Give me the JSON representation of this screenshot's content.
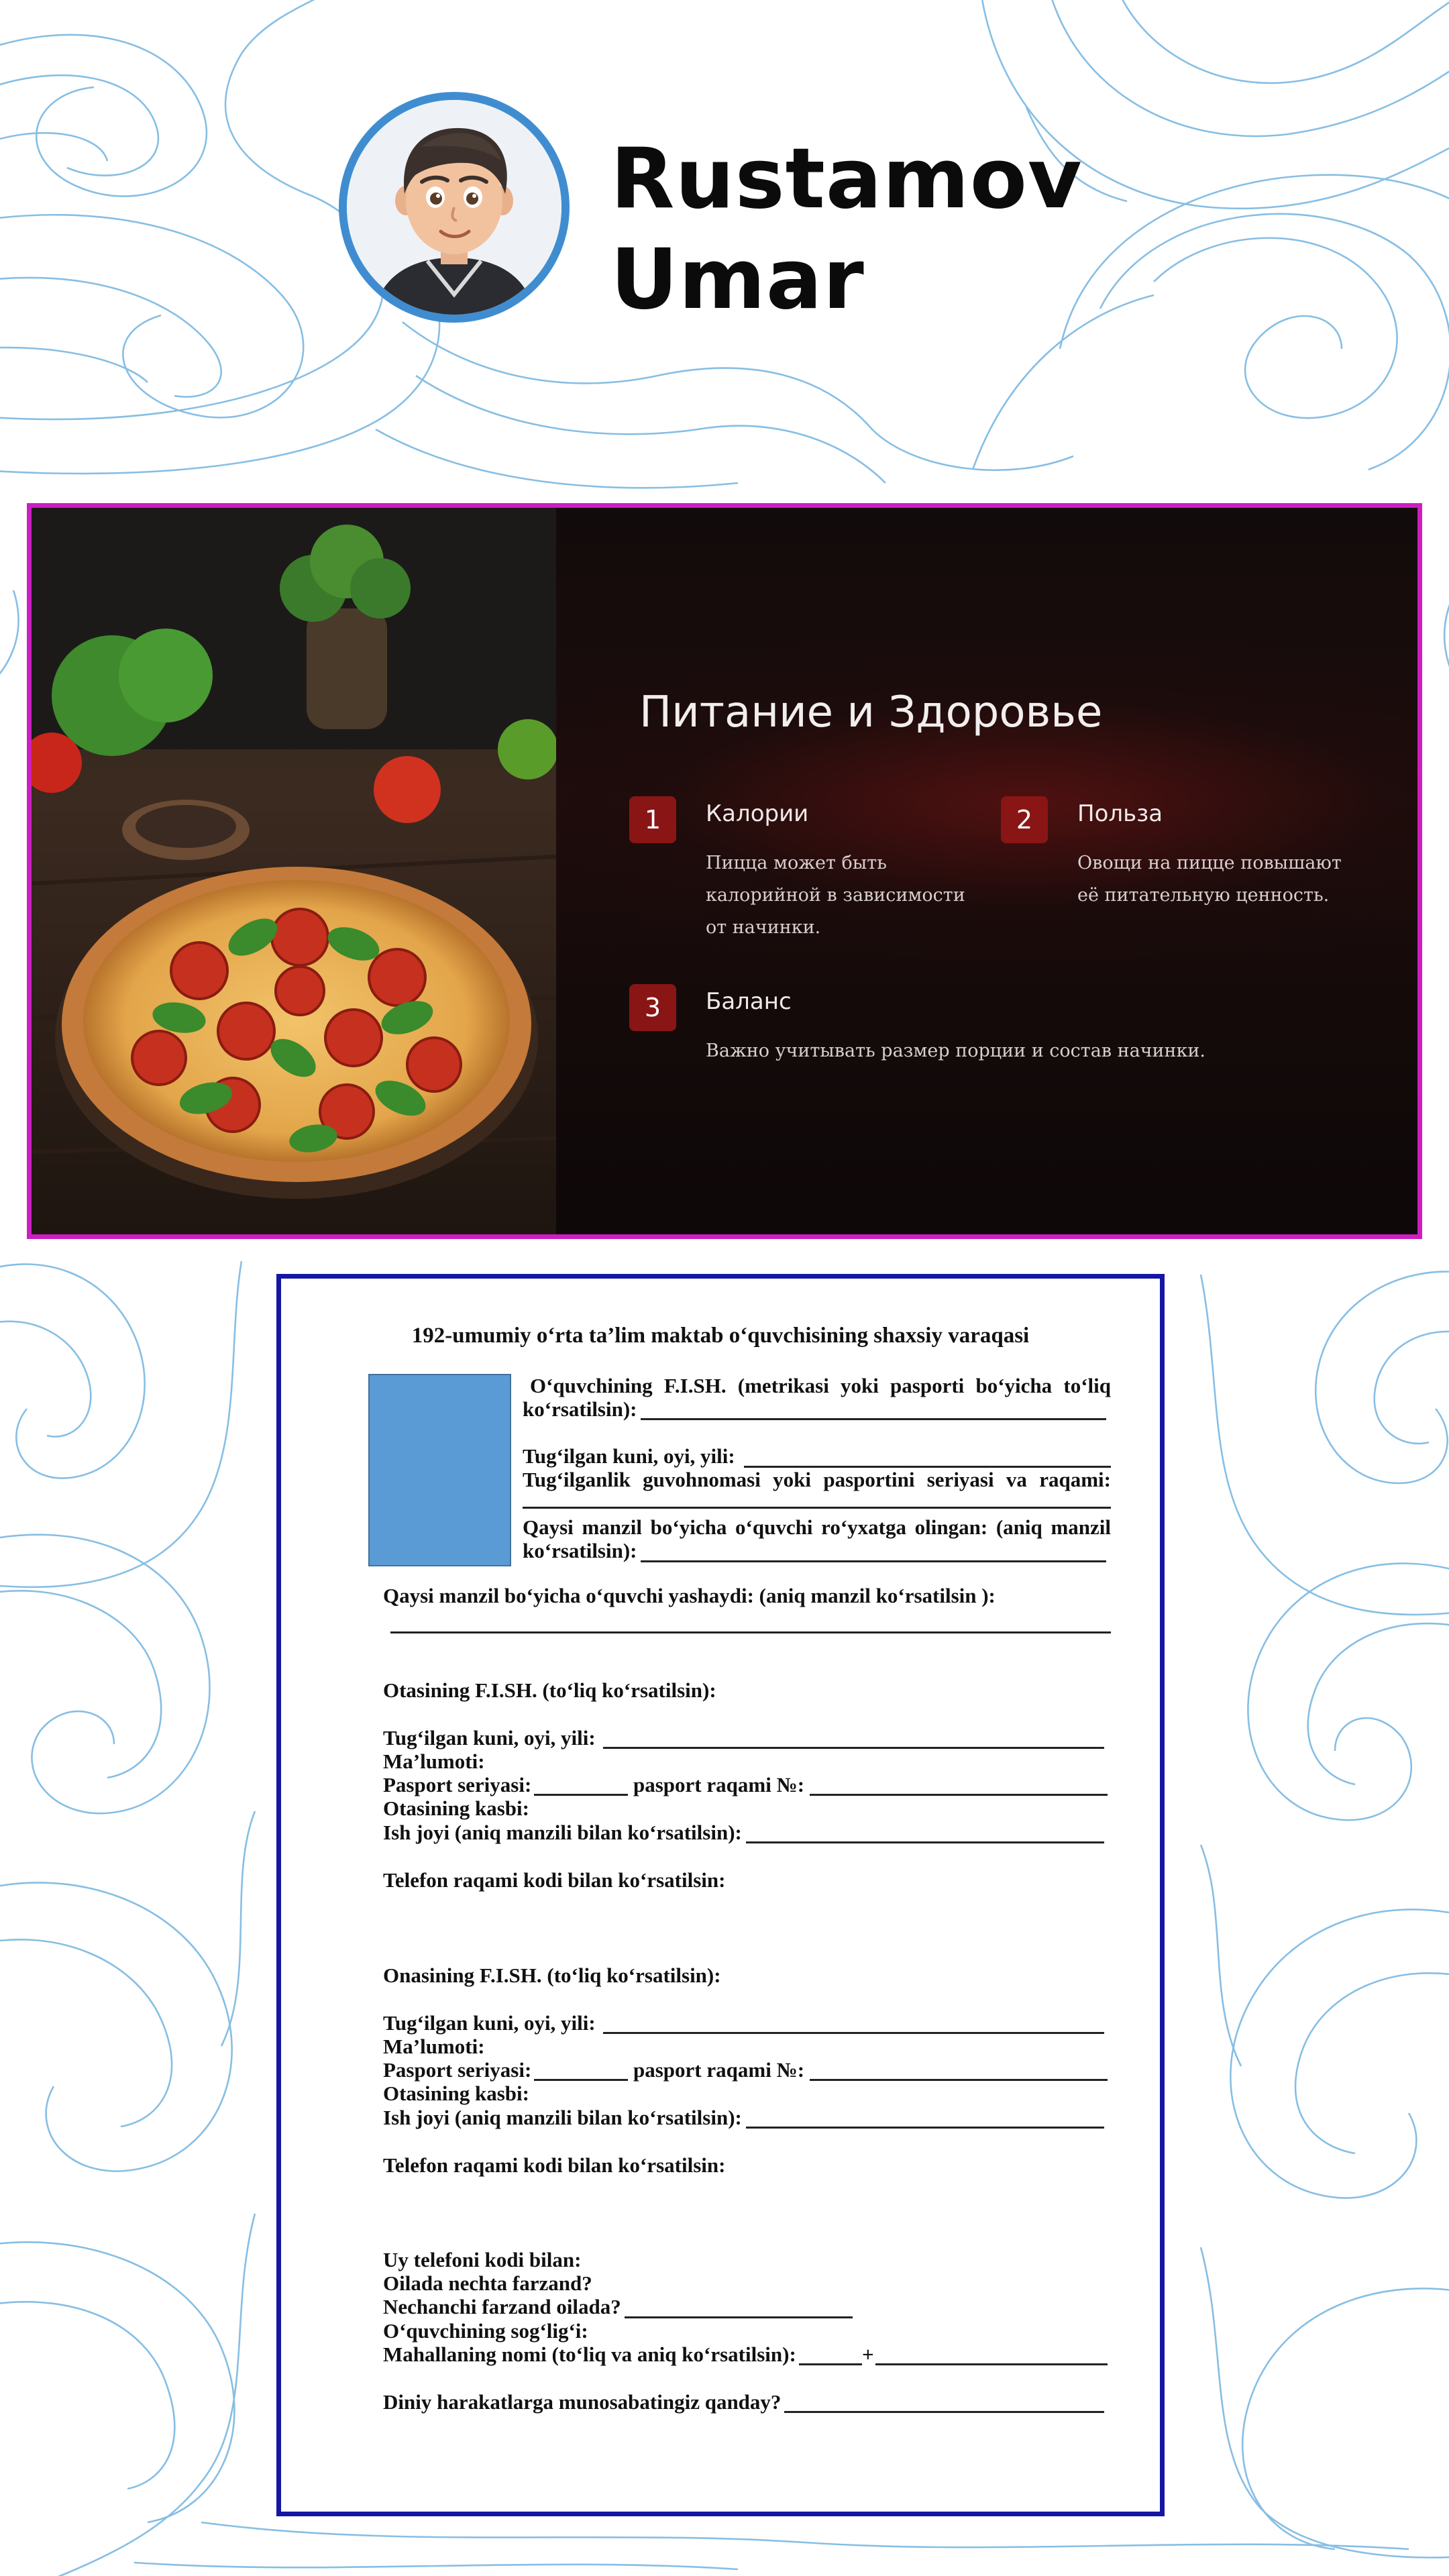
{
  "profile": {
    "first_line": "Rustamov",
    "second_line": "Umar",
    "avatar_icon": "cartoon-boy-avatar",
    "ring_color": "#3f8dd0"
  },
  "slide": {
    "border_color": "#cc1fc2",
    "accent_color": "#8a1515",
    "title": "Питание и Здоровье",
    "items": [
      {
        "num": "1",
        "title": "Калории",
        "text": "Пицца может быть калорийной в зависимости от начинки."
      },
      {
        "num": "2",
        "title": "Польза",
        "text": "Овощи на пицце повышают её питательную ценность."
      },
      {
        "num": "3",
        "title": "Баланс",
        "text": "Важно учитывать размер порции и состав начинки."
      }
    ]
  },
  "form": {
    "border_color": "#1616a4",
    "title": "192-umumiy o‘rta ta’lim maktab o‘quvchisining shaxsiy varaqasi",
    "student_name_1": "O‘quvchining F.I.SH. (metrikasi yoki pasporti bo‘yicha to‘liq",
    "student_name_2": "ko‘rsatilsin):",
    "birth": "Tug‘ilgan kuni, oyi, yili:",
    "cert_1": "Tug‘ilganlik guvohnomasi yoki pasportini seriyasi va raqami:",
    "reg_addr_1": "Qaysi manzil bo‘yicha o‘quvchi ro‘yxatga olingan: (aniq manzil",
    "reg_addr_2": "ko‘rsatilsin):",
    "live_addr": "Qaysi manzil bo‘yicha o‘quvchi yashaydi: (aniq manzil ko‘rsatilsin ):",
    "father_name": "Otasining F.I.SH. (to‘liq ko‘rsatilsin):",
    "father_birth": "Tug‘ilgan kuni, oyi, yili:",
    "father_edu": "Ma’lumoti:",
    "father_passport_a": "Pasport seriyasi:",
    "father_passport_b": "pasport raqami №:",
    "father_job": "Otasining kasbi:",
    "father_work": "Ish joyi (aniq manzili bilan ko‘rsatilsin):",
    "father_phone": "Telefon raqami kodi bilan ko‘rsatilsin:",
    "mother_name": "Onasining F.I.SH. (to‘liq ko‘rsatilsin):",
    "mother_birth": "Tug‘ilgan kuni, oyi, yili:",
    "mother_edu": "Ma’lumoti:",
    "mother_passport_a": "Pasport seriyasi:",
    "mother_passport_b": "pasport raqami №:",
    "mother_job": "Otasining kasbi:",
    "mother_work": "Ish joyi (aniq manzili bilan ko‘rsatilsin):",
    "mother_phone": "Telefon raqami kodi bilan ko‘rsatilsin:",
    "home_phone": "Uy telefoni kodi bilan:",
    "children_count": "Oilada nechta farzand?",
    "child_order": "Nechanchi farzand oilada?",
    "health": "O‘quvchining sog‘lig‘i:",
    "mahalla": "Mahallaning nomi (to‘liq va aniq ko‘rsatilsin):",
    "mahalla_plus": "+",
    "religion": "Diniy harakatlarga munosabatingiz qanday?"
  }
}
